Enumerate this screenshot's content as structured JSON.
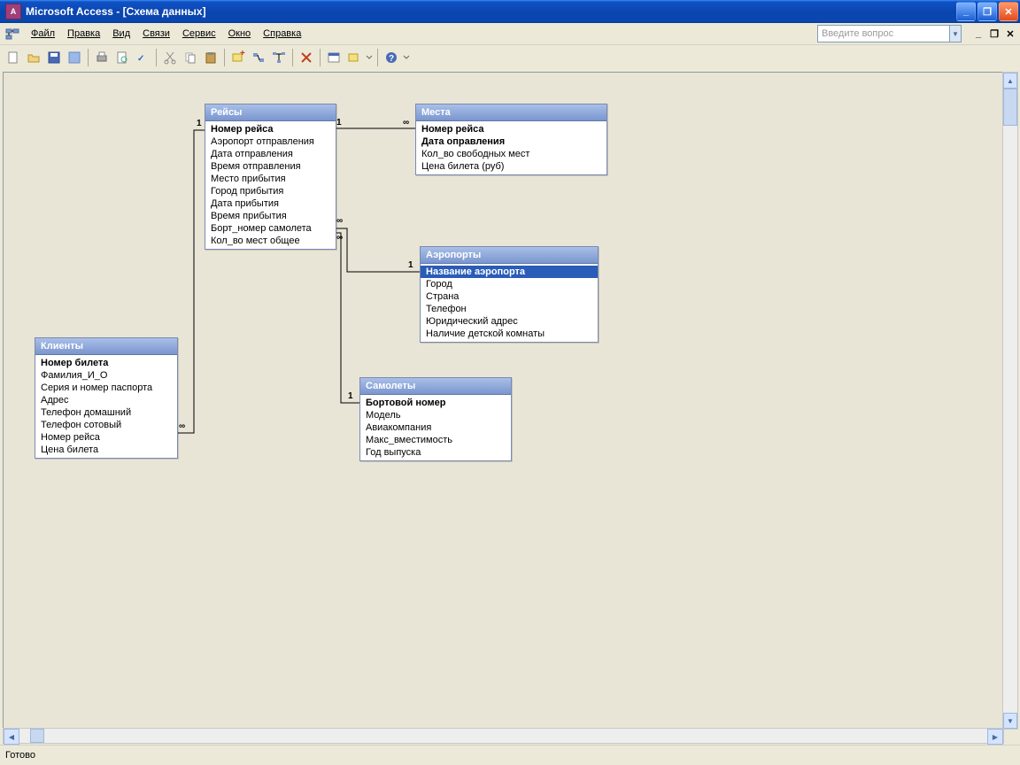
{
  "title": "Microsoft Access - [Схема данных]",
  "menu": {
    "file": "Файл",
    "edit": "Правка",
    "view": "Вид",
    "links": "Связи",
    "service": "Сервис",
    "window": "Окно",
    "help": "Справка"
  },
  "helpbox": {
    "placeholder": "Введите вопрос"
  },
  "status": "Готово",
  "tables": {
    "flights": {
      "title": "Рейсы",
      "fields": [
        "Номер рейса",
        "Аэропорт отправления",
        "Дата отправления",
        "Время отправления",
        "Место прибытия",
        "Город прибытия",
        "Дата прибытия",
        "Время прибытия",
        "Борт_номер самолета",
        "Кол_во мест общее"
      ],
      "pk": [
        0
      ]
    },
    "seats": {
      "title": "Места",
      "fields": [
        "Номер рейса",
        "Дата оправления",
        "Кол_во свободных мест",
        "Цена билета (руб)"
      ],
      "pk": [
        0,
        1
      ]
    },
    "clients": {
      "title": "Клиенты",
      "fields": [
        "Номер билета",
        "Фамилия_И_О",
        "Серия и номер паспорта",
        "Адрес",
        "Телефон домашний",
        "Телефон сотовый",
        "Номер рейса",
        "Цена билета"
      ],
      "pk": [
        0
      ]
    },
    "airports": {
      "title": "Аэропорты",
      "fields": [
        "Название аэропорта",
        "Город",
        "Страна",
        "Телефон",
        "Юридический адрес",
        "Наличие детской комнаты"
      ],
      "pk": [
        0
      ],
      "selected": [
        0
      ]
    },
    "planes": {
      "title": "Самолеты",
      "fields": [
        "Бортовой номер",
        "Модель",
        "Авиакомпания",
        "Макс_вместимость",
        "Год выпуска"
      ],
      "pk": [
        0
      ]
    }
  },
  "relations": {
    "labels": {
      "one": "1",
      "many": "∞"
    }
  }
}
